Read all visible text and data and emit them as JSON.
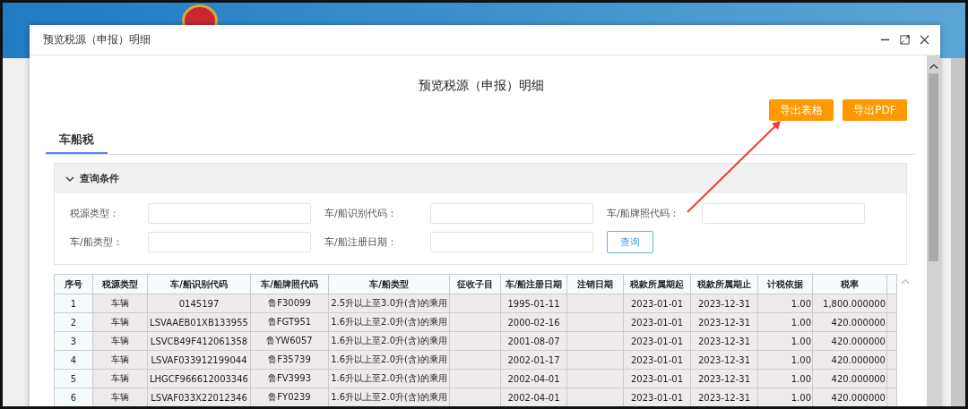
{
  "dialog": {
    "title": "预览税源（申报）明细"
  },
  "heading": "预览税源（申报）明细",
  "buttons": [
    {
      "label": "导出表格"
    },
    {
      "label": "导出PDF"
    }
  ],
  "tabs": [
    {
      "label": "车船税",
      "selected": true
    }
  ],
  "query_panel": {
    "title": "查询条件",
    "expanded": true,
    "fields": [
      {
        "label": "税源类型："
      },
      {
        "label": "车/船识别代码："
      },
      {
        "label": "车/船牌照代码："
      },
      {
        "label": "车/船类型："
      },
      {
        "label": "车/船注册日期："
      }
    ],
    "search_button": "查询"
  },
  "table": {
    "columns": [
      "序号",
      "税源类型",
      "车/船识别代码",
      "车/船牌照代码",
      "车/船类型",
      "征收子目",
      "车/船注册日期",
      "注销日期",
      "税款所属期起",
      "税款所属期止",
      "计税依据",
      "税率"
    ],
    "rows": [
      [
        "1",
        "车辆",
        "0145197",
        "鲁F30099",
        "2.5升以上至3.0升(含)的乘用",
        "",
        "1995-01-11",
        "",
        "2023-01-01",
        "2023-12-31",
        "1.00",
        "1,800.000000"
      ],
      [
        "2",
        "车辆",
        "LSVAAEB01XB133955",
        "鲁FGT951",
        "1.6升以上至2.0升(含)的乘用",
        "",
        "2000-02-16",
        "",
        "2023-01-01",
        "2023-12-31",
        "1.00",
        "420.000000"
      ],
      [
        "3",
        "车辆",
        "LSVCB49F412061358",
        "鲁YW6057",
        "1.6升以上至2.0升(含)的乘用",
        "",
        "2001-08-07",
        "",
        "2023-01-01",
        "2023-12-31",
        "1.00",
        "420.000000"
      ],
      [
        "4",
        "车辆",
        "LSVAF033912199044",
        "鲁F35739",
        "1.6升以上至2.0升(含)的乘用",
        "",
        "2002-01-17",
        "",
        "2023-01-01",
        "2023-12-31",
        "1.00",
        "420.000000"
      ],
      [
        "5",
        "车辆",
        "LHGCF966612003346",
        "鲁FV3993",
        "1.6升以上至2.0升(含)的乘用",
        "",
        "2002-04-01",
        "",
        "2023-01-01",
        "2023-12-31",
        "1.00",
        "420.000000"
      ],
      [
        "6",
        "车辆",
        "LSVAF033X22012346",
        "鲁FY0239",
        "1.6升以上至2.0升(含)的乘用",
        "",
        "2002-04-01",
        "",
        "2023-01-01",
        "2023-12-31",
        "1.00",
        "420.000000"
      ]
    ]
  }
}
